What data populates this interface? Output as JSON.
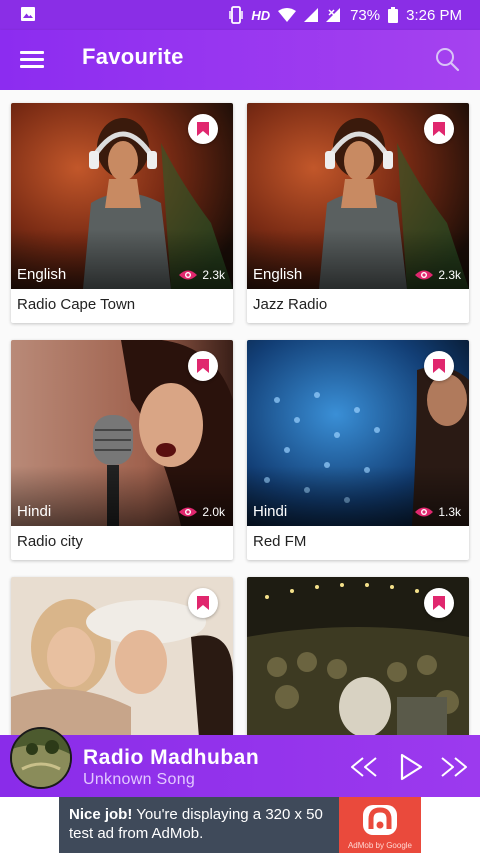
{
  "status_bar": {
    "network": "HD",
    "battery": "73%",
    "time": "3:26 PM"
  },
  "app_bar": {
    "title": "Favourite",
    "menu_icon": "hamburger-menu-icon",
    "search_icon": "search-icon"
  },
  "stations": [
    {
      "name": "Radio Cape Town",
      "language": "English",
      "views": "2.3k"
    },
    {
      "name": "Jazz Radio",
      "language": "English",
      "views": "2.3k"
    },
    {
      "name": "Radio city",
      "language": "Hindi",
      "views": "2.0k"
    },
    {
      "name": "Red FM",
      "language": "Hindi",
      "views": "1.3k"
    },
    {
      "name": "",
      "language": "",
      "views": ""
    },
    {
      "name": "",
      "language": "",
      "views": ""
    }
  ],
  "player": {
    "station": "Radio Madhuban",
    "song": "Unknown Song"
  },
  "ad": {
    "headline": "Nice job!",
    "text": "You're displaying a 320 x 50 test ad from AdMob.",
    "brand": "AdMob by Google"
  },
  "colors": {
    "primary": "#8c2cf0",
    "accent": "#e0276e"
  }
}
